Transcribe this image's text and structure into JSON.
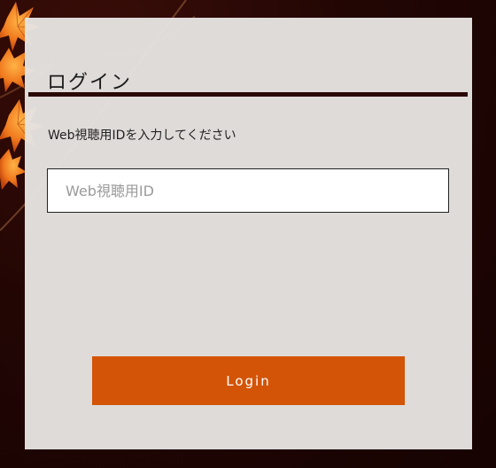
{
  "login_form": {
    "title": "ログイン",
    "instruction": "Web視聴用IDを入力してください",
    "id_input": {
      "value": "",
      "placeholder": "Web視聴用ID"
    },
    "login_button_label": "Login"
  },
  "colors": {
    "background": "#1f0604",
    "panel": "#e6e4e2",
    "title_rule": "#2a0804",
    "button": "#d35406",
    "button_text": "#ffffff",
    "leaf": "#f07a1e"
  },
  "background_decoration": {
    "icon": "maple-leaves"
  }
}
